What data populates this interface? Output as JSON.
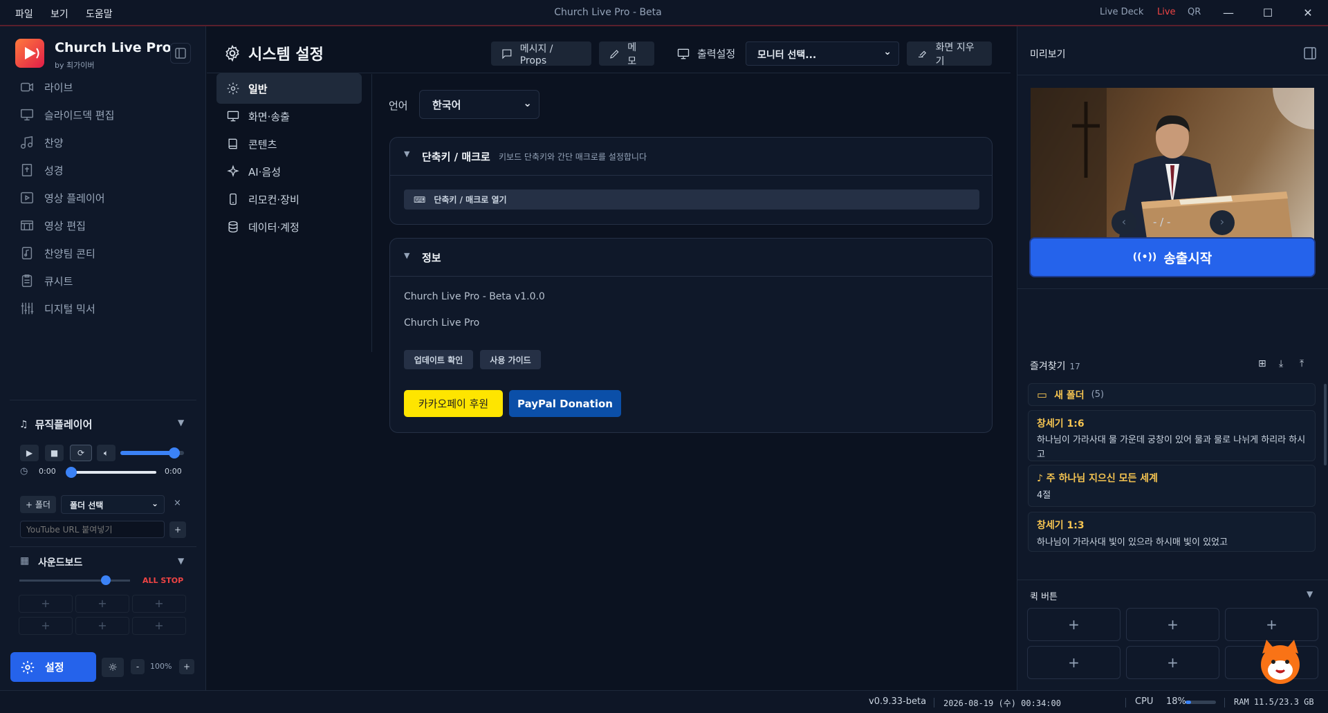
{
  "menubar": {
    "items": [
      "파일",
      "보기",
      "도움말"
    ],
    "title": "Church Live Pro - Beta",
    "right_links": [
      "Live Deck",
      "Live",
      "QR"
    ]
  },
  "sidebar": {
    "app_name": "Church Live Pro",
    "app_by": "by 최가이버",
    "nav": [
      {
        "label": "라이브",
        "icon": "video-icon"
      },
      {
        "label": "슬라이드덱 편집",
        "icon": "monitor-icon"
      },
      {
        "label": "찬양",
        "icon": "music-icon"
      },
      {
        "label": "성경",
        "icon": "bible-icon"
      },
      {
        "label": "영상 플레이어",
        "icon": "play-icon"
      },
      {
        "label": "영상 편집",
        "icon": "film-icon"
      },
      {
        "label": "찬양팀 콘티",
        "icon": "music-file-icon"
      },
      {
        "label": "큐시트",
        "icon": "clipboard-icon"
      },
      {
        "label": "디지털 믹서",
        "icon": "mixer-icon"
      }
    ],
    "music_player": {
      "title": "뮤직플레이어",
      "time_start": "0:00",
      "time_end": "0:00",
      "volume_level": 0.85,
      "progress": 0.0
    },
    "folder_add": "+ 폴더",
    "folder_select": "폴더 선택",
    "youtube_placeholder": "YouTube URL 붙여넣기",
    "soundboard": {
      "title": "사운드보드",
      "all_stop": "ALL STOP",
      "volume_level": 0.78
    },
    "settings_label": "설정",
    "zoom": "100%",
    "zoom_minus": "-",
    "zoom_plus": "+"
  },
  "header": {
    "title": "시스템 설정",
    "message_btn": "메시지 / Props",
    "memo_btn": "메모",
    "output_label": "출력설정",
    "monitor_select": "모니터 선택...",
    "clear_btn": "화면 지우기"
  },
  "tabs": [
    {
      "label": "일반",
      "icon": "gear-icon"
    },
    {
      "label": "화면·송출",
      "icon": "monitor-icon"
    },
    {
      "label": "콘텐츠",
      "icon": "book-icon"
    },
    {
      "label": "AI·음성",
      "icon": "sparkle-icon"
    },
    {
      "label": "리모컨·장비",
      "icon": "phone-icon"
    },
    {
      "label": "데이터·계정",
      "icon": "database-icon"
    }
  ],
  "general": {
    "lang_label": "언어",
    "lang_value": "한국어",
    "shortcut": {
      "title": "단축키 / 매크로",
      "desc": "키보드 단축키와 간단 매크로를 설정합니다",
      "open_btn": "단축키 / 매크로 열기"
    },
    "info": {
      "title": "정보",
      "version": "Church Live Pro - Beta v1.0.0",
      "name": "Church Live Pro",
      "update_btn": "업데이트 확인",
      "guide_btn": "사용 가이드",
      "kakao_btn": "카카오페이 후원",
      "paypal_btn": "PayPal Donation"
    }
  },
  "preview": {
    "title": "미리보기",
    "page": "- / -",
    "broadcast_btn": "송출시작"
  },
  "favorites": {
    "title": "즐겨찾기",
    "count": "17",
    "folder": "새 폴더",
    "folder_count": "(5)",
    "items": [
      {
        "title": "창세기 1:6",
        "body": "하나님이 가라사대 물 가운데 궁창이 있어 물과 물로 나뉘게 하리라 하시고"
      },
      {
        "title": "♪ 주 하나님 지으신 모든 세계",
        "body": "4절"
      },
      {
        "title": "창세기 1:3",
        "body": "하나님이 가라사대 빛이 있으라 하시매 빛이 있었고"
      }
    ]
  },
  "quick": {
    "title": "퀵 버튼",
    "button": "+"
  },
  "status": {
    "version": "v0.9.33-beta",
    "datetime": "2026-08-19 (수) 00:34:00",
    "cpu_label": "CPU",
    "cpu": "18%",
    "cpu_level": 0.18,
    "ram": "RAM 11.5/23.3 GB"
  },
  "colors": {
    "accent": "#2563eb",
    "live": "#ef4444",
    "kakao": "#fee500",
    "paypal": "#0b4fa8",
    "fav_title": "#f5c451"
  }
}
